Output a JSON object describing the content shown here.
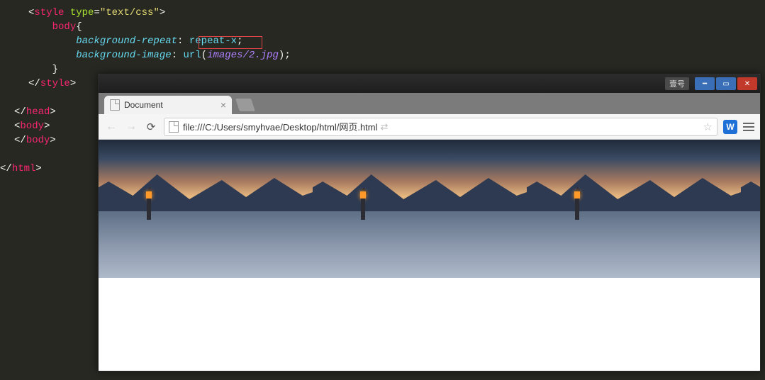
{
  "code": {
    "l1": {
      "style_open": "<",
      "style_tag": "style",
      "attr_name": "type",
      "eq": "=",
      "attr_val": "\"text/css\"",
      "close": ">"
    },
    "l2": {
      "selector": "body",
      "brace": "{"
    },
    "l3": {
      "prop": "background-repeat",
      "colon": ":",
      "val": "repeat-x",
      "semi": ";"
    },
    "l4": {
      "prop": "background-image",
      "colon": ":",
      "func": "url",
      "paren_o": "(",
      "arg": "images/2.jpg",
      "paren_c": ")",
      "semi": ";"
    },
    "l5": {
      "brace": "}"
    },
    "l6": {
      "open": "</",
      "tag": "style",
      "close": ">"
    },
    "l7": {
      "open": "</",
      "tag": "head",
      "close": ">"
    },
    "l8": {
      "open": "<",
      "tag": "body",
      "close": ">"
    },
    "l9": {
      "open": "</",
      "tag": "body",
      "close": ">"
    },
    "l10": {
      "open": "</",
      "tag": "html",
      "close": ">"
    }
  },
  "browser": {
    "ime_label": "壹号",
    "tab_title": "Document",
    "tab_close": "×",
    "url": "file:///C:/Users/smyhvae/Desktop/html/网页.html",
    "ext_letter": "W"
  }
}
